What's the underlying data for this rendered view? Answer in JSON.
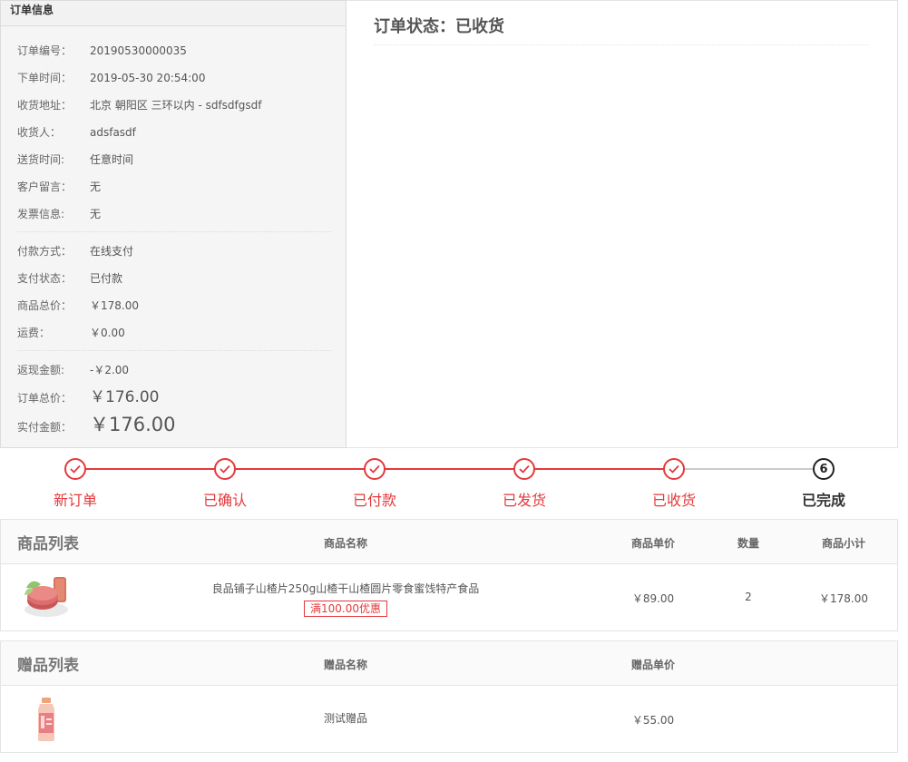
{
  "order_info": {
    "title": "订单信息",
    "rows": [
      {
        "label": "订单编号：",
        "value": "20190530000035"
      },
      {
        "label": "下单时间：",
        "value": "2019-05-30 20:54:00"
      },
      {
        "label": "收货地址：",
        "value": "北京 朝阳区 三环以内 - sdfsdfgsdf"
      },
      {
        "label": "收货人：",
        "value": "adsfasdf"
      },
      {
        "label": "送货时间:",
        "value": "任意时间"
      },
      {
        "label": "客户留言：",
        "value": "无"
      },
      {
        "label": "发票信息:",
        "value": "无"
      }
    ],
    "pay_rows": [
      {
        "label": "付款方式：",
        "value": "在线支付"
      },
      {
        "label": "支付状态：",
        "value": "已付款"
      },
      {
        "label": "商品总价：",
        "value": "￥178.00"
      },
      {
        "label": "运费：",
        "value": "￥0.00"
      }
    ],
    "cashback": {
      "label": "返现金额:",
      "value": "-￥2.00"
    },
    "order_total": {
      "label": "订单总价：",
      "value": "￥176.00"
    },
    "paid_amount": {
      "label": "实付金额：",
      "value": "￥176.00"
    }
  },
  "status": {
    "title": "订单状态：已收货"
  },
  "progress": {
    "steps": [
      {
        "label": "新订单",
        "state": "done"
      },
      {
        "label": "已确认",
        "state": "done"
      },
      {
        "label": "已付款",
        "state": "done"
      },
      {
        "label": "已发货",
        "state": "done"
      },
      {
        "label": "已收货",
        "state": "done"
      },
      {
        "label": "已完成",
        "state": "pending",
        "number": "6"
      }
    ],
    "active_color": "#e4393c",
    "inactive_color": "#cccccc"
  },
  "goods": {
    "title": "商品列表",
    "columns": {
      "name": "商品名称",
      "price": "商品单价",
      "qty": "数量",
      "subtotal": "商品小计"
    },
    "items": [
      {
        "name": "良品铺子山楂片250g山楂干山楂圆片零食蜜饯特产食品",
        "promo": "满100.00优惠",
        "price": "￥89.00",
        "qty": "2",
        "subtotal": "￥178.00",
        "image_icon": "hawthorn-snack-image"
      }
    ]
  },
  "gifts": {
    "title": "赠品列表",
    "columns": {
      "name": "赠品名称",
      "price": "赠品单价"
    },
    "items": [
      {
        "name": "测试赠品",
        "price": "￥55.00",
        "image_icon": "drink-bottle-image"
      }
    ]
  }
}
